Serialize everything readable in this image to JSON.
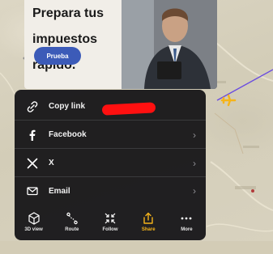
{
  "ad": {
    "headline_lines": [
      "Prepara tus",
      "impuestos",
      "rápido."
    ],
    "cta_label": "Prueba"
  },
  "share_sheet": {
    "rows": [
      {
        "icon": "link-icon",
        "label": "Copy link",
        "has_chevron": false
      },
      {
        "icon": "facebook-icon",
        "label": "Facebook",
        "has_chevron": true
      },
      {
        "icon": "x-icon",
        "label": "X",
        "has_chevron": true
      },
      {
        "icon": "email-icon",
        "label": "Email",
        "has_chevron": true
      }
    ],
    "chevron": "›",
    "toolbar": [
      {
        "icon": "3d-view-icon",
        "label": "3D view"
      },
      {
        "icon": "route-icon",
        "label": "Route"
      },
      {
        "icon": "follow-icon",
        "label": "Follow"
      },
      {
        "icon": "share-icon",
        "label": "Share",
        "active": true
      },
      {
        "icon": "more-icon",
        "label": "More"
      }
    ]
  },
  "colors": {
    "sheet_bg": "#18181a",
    "accent": "#f5b41a",
    "redaction": "#ff1010",
    "flight_path": "#6a4ce0",
    "ad_cta": "#3c5bb8"
  }
}
